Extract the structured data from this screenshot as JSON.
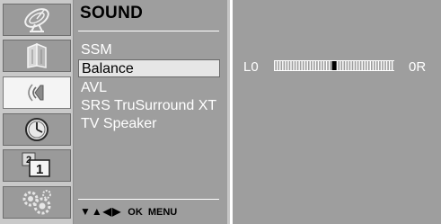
{
  "icons": [
    {
      "name": "picture-satellite-icon",
      "active": false
    },
    {
      "name": "picture-frame-icon",
      "active": false
    },
    {
      "name": "sound-speaker-icon",
      "active": true
    },
    {
      "name": "time-clock-icon",
      "active": false
    },
    {
      "name": "channel-number-icon",
      "active": false
    },
    {
      "name": "option-gears-icon",
      "active": false
    }
  ],
  "menu": {
    "title": "SOUND",
    "items": [
      "SSM",
      "Balance",
      "AVL",
      "SRS TruSurround XT",
      "TV Speaker"
    ],
    "selected_index": 1
  },
  "nav_hint": {
    "arrows": "▼▲◀▶",
    "ok": "OK",
    "menu": "MENU"
  },
  "balance": {
    "left_label": "L0",
    "right_label": "0R",
    "position": 0.5
  },
  "colors": {
    "panel": "#9e9e9e",
    "icon_column": "#c9c9c9",
    "selected_bg": "#e6e6e6"
  }
}
